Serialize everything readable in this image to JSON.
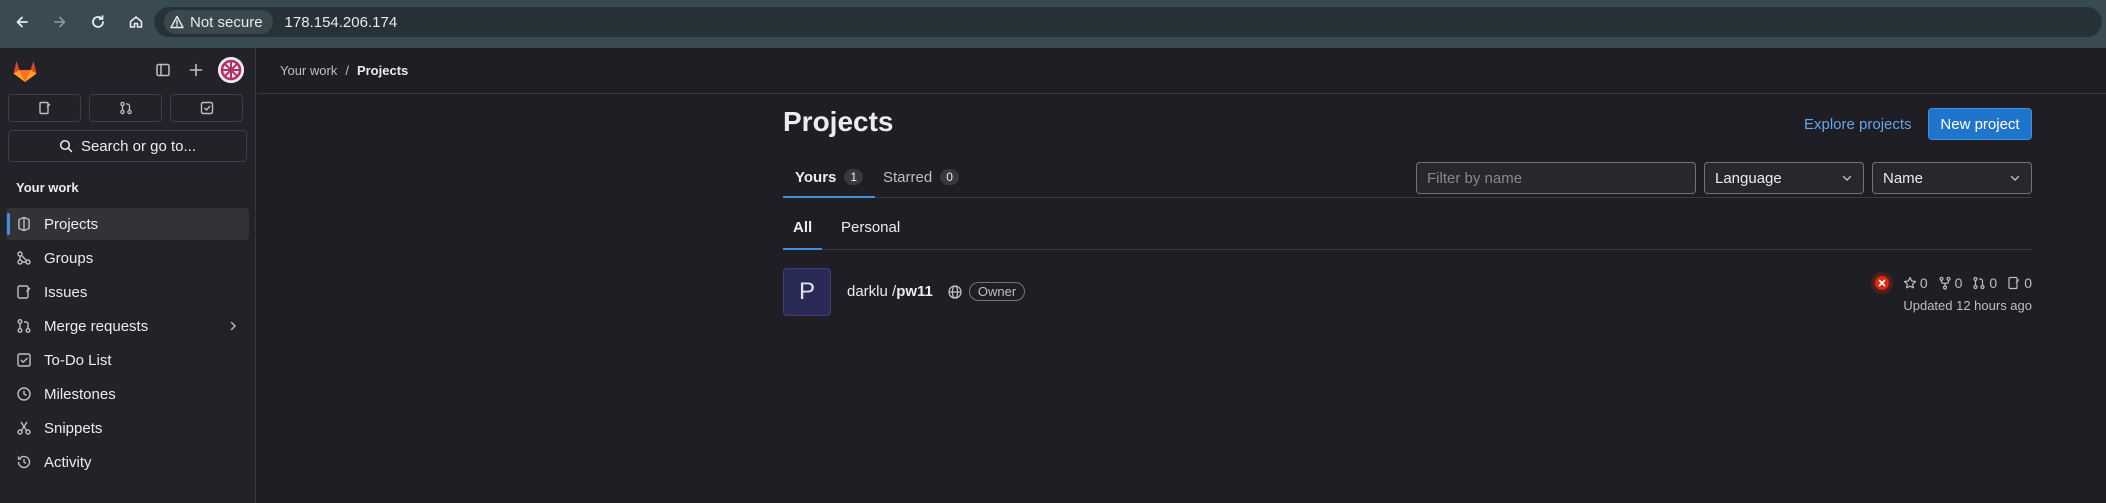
{
  "browser": {
    "security_label": "Not secure",
    "url": "178.154.206.174"
  },
  "sidebar": {
    "search_label": "Search or go to...",
    "section_title": "Your work",
    "items": [
      {
        "label": "Projects",
        "icon": "project-icon"
      },
      {
        "label": "Groups",
        "icon": "group-icon"
      },
      {
        "label": "Issues",
        "icon": "issues-icon"
      },
      {
        "label": "Merge requests",
        "icon": "merge-request-icon"
      },
      {
        "label": "To-Do List",
        "icon": "todo-icon"
      },
      {
        "label": "Milestones",
        "icon": "clock-icon"
      },
      {
        "label": "Snippets",
        "icon": "snippet-icon"
      },
      {
        "label": "Activity",
        "icon": "history-icon"
      }
    ]
  },
  "breadcrumb": {
    "parent": "Your work",
    "separator": "/",
    "current": "Projects"
  },
  "main": {
    "title": "Projects",
    "explore_link": "Explore projects",
    "new_project": "New project",
    "tabs": [
      {
        "label": "Yours",
        "count": "1"
      },
      {
        "label": "Starred",
        "count": "0"
      }
    ],
    "filter_placeholder": "Filter by name",
    "language_select": "Language",
    "sort_select": "Name",
    "subtabs": [
      "All",
      "Personal"
    ]
  },
  "project": {
    "avatar_letter": "P",
    "namespace": "darklu / ",
    "name": "pw11",
    "role": "Owner",
    "stars": "0",
    "forks": "0",
    "merge_requests": "0",
    "issues": "0",
    "updated": "Updated 12 hours ago"
  },
  "colors": {
    "accent": "#428fdc",
    "primary_button": "#1f75cb",
    "link": "#63a6e9",
    "background": "#1f1e24",
    "sidebar": "#232228",
    "ci_failed": "#dd2b0e"
  }
}
